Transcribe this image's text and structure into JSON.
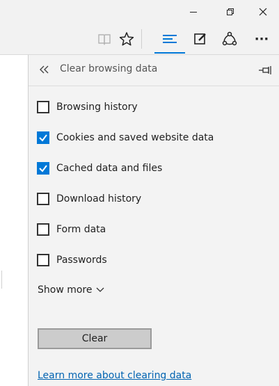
{
  "window": {
    "buttons": [
      {
        "name": "minimize",
        "icon": "minimize-icon"
      },
      {
        "name": "restore",
        "icon": "restore-icon"
      },
      {
        "name": "close",
        "icon": "close-icon"
      }
    ]
  },
  "toolbar": {
    "icons": [
      "reading-view-icon",
      "favorites-star-icon",
      "hub-icon",
      "web-note-icon",
      "share-icon",
      "more-icon"
    ],
    "more_label": "···",
    "accent": "#0078d7"
  },
  "panel": {
    "title": "Clear browsing data",
    "options": [
      {
        "label": "Browsing history",
        "checked": false
      },
      {
        "label": "Cookies and saved website data",
        "checked": true
      },
      {
        "label": "Cached data and files",
        "checked": true
      },
      {
        "label": "Download history",
        "checked": false
      },
      {
        "label": "Form data",
        "checked": false
      },
      {
        "label": "Passwords",
        "checked": false
      }
    ],
    "show_more": "Show more",
    "clear_button": "Clear",
    "learn_more": "Learn more about clearing data"
  }
}
